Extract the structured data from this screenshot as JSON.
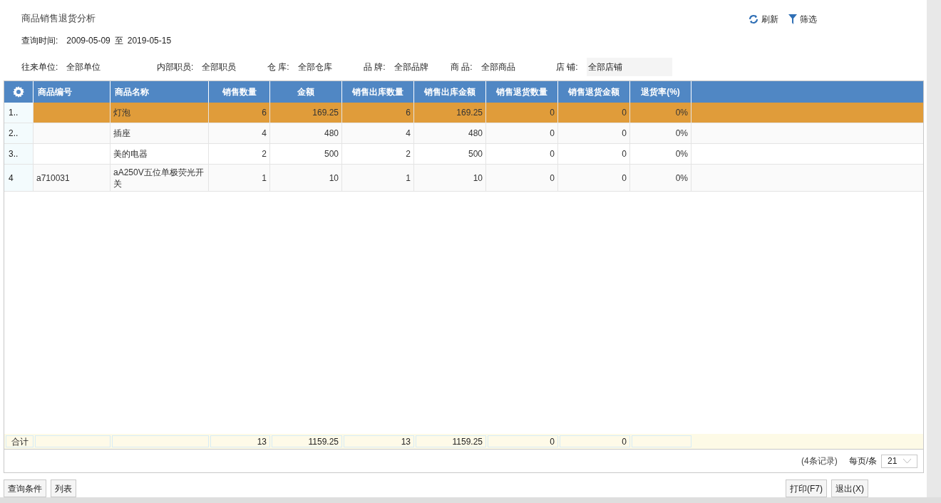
{
  "title": "商品销售退货分析",
  "toolbar": [
    {
      "kind": "refresh",
      "label": "刷新"
    },
    {
      "kind": "filter",
      "label": "筛选"
    }
  ],
  "query_time": {
    "label": "查询时间:",
    "from": "2009-05-09",
    "sep": "至",
    "to": "2019-05-15"
  },
  "filters": [
    {
      "label": "往来单位:",
      "value": "全部单位",
      "kind": "text"
    },
    {
      "label": "内部职员:",
      "value": "全部职员",
      "kind": "text"
    },
    {
      "label": "仓 库:",
      "value": "全部仓库",
      "kind": "text"
    },
    {
      "label": "品 牌:",
      "value": "全部品牌",
      "kind": "text"
    },
    {
      "label": "商 品:",
      "value": "全部商品",
      "kind": "text"
    },
    {
      "label": "店 铺:",
      "value": "全部店铺",
      "kind": "field"
    }
  ],
  "table": {
    "columns": [
      "商品编号",
      "商品名称",
      "销售数量",
      "金额",
      "销售出库数量",
      "销售出库金额",
      "销售退货数量",
      "销售退货金额",
      "退货率(%)"
    ],
    "rows": [
      {
        "index": "1..",
        "selected": true,
        "cells": [
          "",
          "灯泡",
          "6",
          "169.25",
          "6",
          "169.25",
          "0",
          "0",
          "0%"
        ]
      },
      {
        "index": "2..",
        "selected": false,
        "cells": [
          "",
          "插座",
          "4",
          "480",
          "4",
          "480",
          "0",
          "0",
          "0%"
        ]
      },
      {
        "index": "3..",
        "selected": false,
        "cells": [
          "",
          "美的电器",
          "2",
          "500",
          "2",
          "500",
          "0",
          "0",
          "0%"
        ]
      },
      {
        "index": "4",
        "selected": false,
        "cells": [
          "a710031",
          "aA250V五位单极荧光开关",
          "1",
          "10",
          "1",
          "10",
          "0",
          "0",
          "0%"
        ]
      }
    ],
    "total": {
      "label": "合计",
      "cells": [
        "",
        "",
        "13",
        "1159.25",
        "13",
        "1159.25",
        "0",
        "0",
        ""
      ]
    }
  },
  "pagination": {
    "records": "(4条记录)",
    "per_page_label": "每页/条",
    "per_page": "21"
  },
  "left_buttons": [
    "查询条件",
    "列表"
  ],
  "right_buttons": [
    "打印(F7)",
    "退出(X)"
  ]
}
